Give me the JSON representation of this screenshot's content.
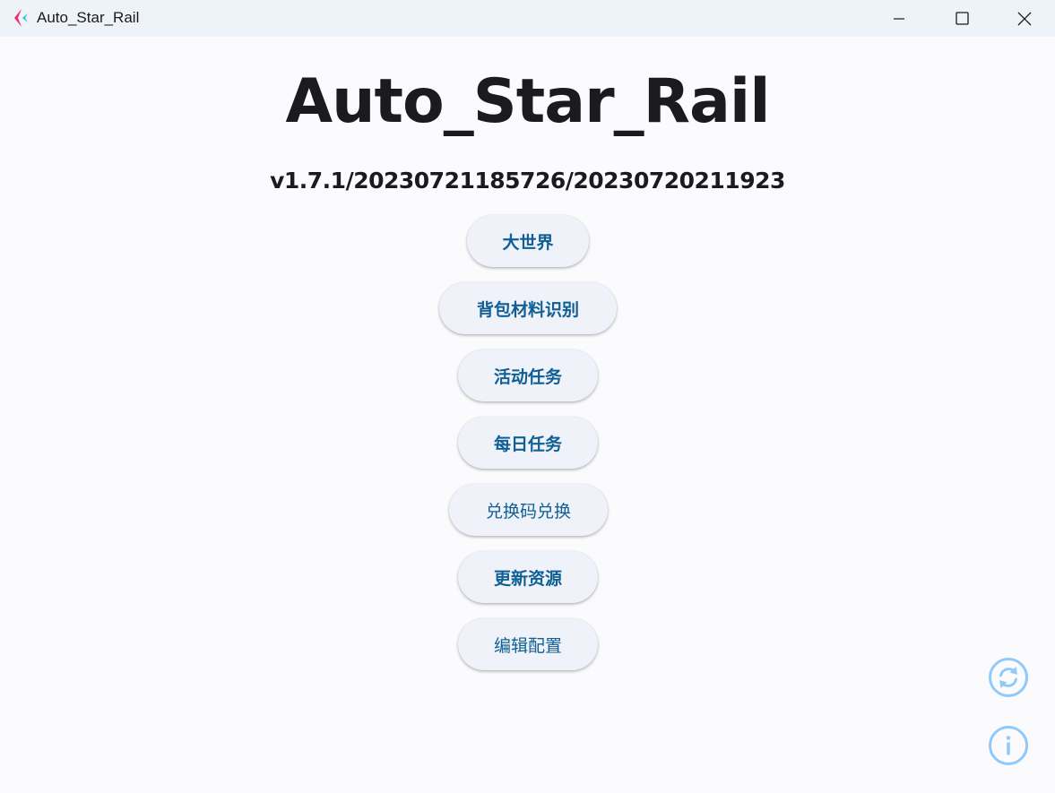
{
  "window": {
    "title": "Auto_Star_Rail"
  },
  "header": {
    "title": "Auto_Star_Rail",
    "version": "v1.7.1/20230721185726/20230720211923"
  },
  "menu": {
    "buttons": [
      {
        "label": "大世界"
      },
      {
        "label": "背包材料识别"
      },
      {
        "label": "活动任务"
      },
      {
        "label": "每日任务"
      },
      {
        "label": "兑换码兑换"
      },
      {
        "label": "更新资源"
      },
      {
        "label": "编辑配置"
      }
    ]
  },
  "colors": {
    "accent_text": "#0f5f94",
    "button_bg": "#eff2f9",
    "fab_blue": "#90caf9",
    "titlebar_bg": "#eef2f9",
    "app_icon_pink": "#e8336d",
    "app_icon_cyan": "#37b8d8"
  },
  "icons": {
    "app": "app-logo-icon",
    "minimize": "minimize-icon",
    "maximize": "maximize-icon",
    "close": "close-icon",
    "refresh": "refresh-icon",
    "info": "info-icon"
  }
}
